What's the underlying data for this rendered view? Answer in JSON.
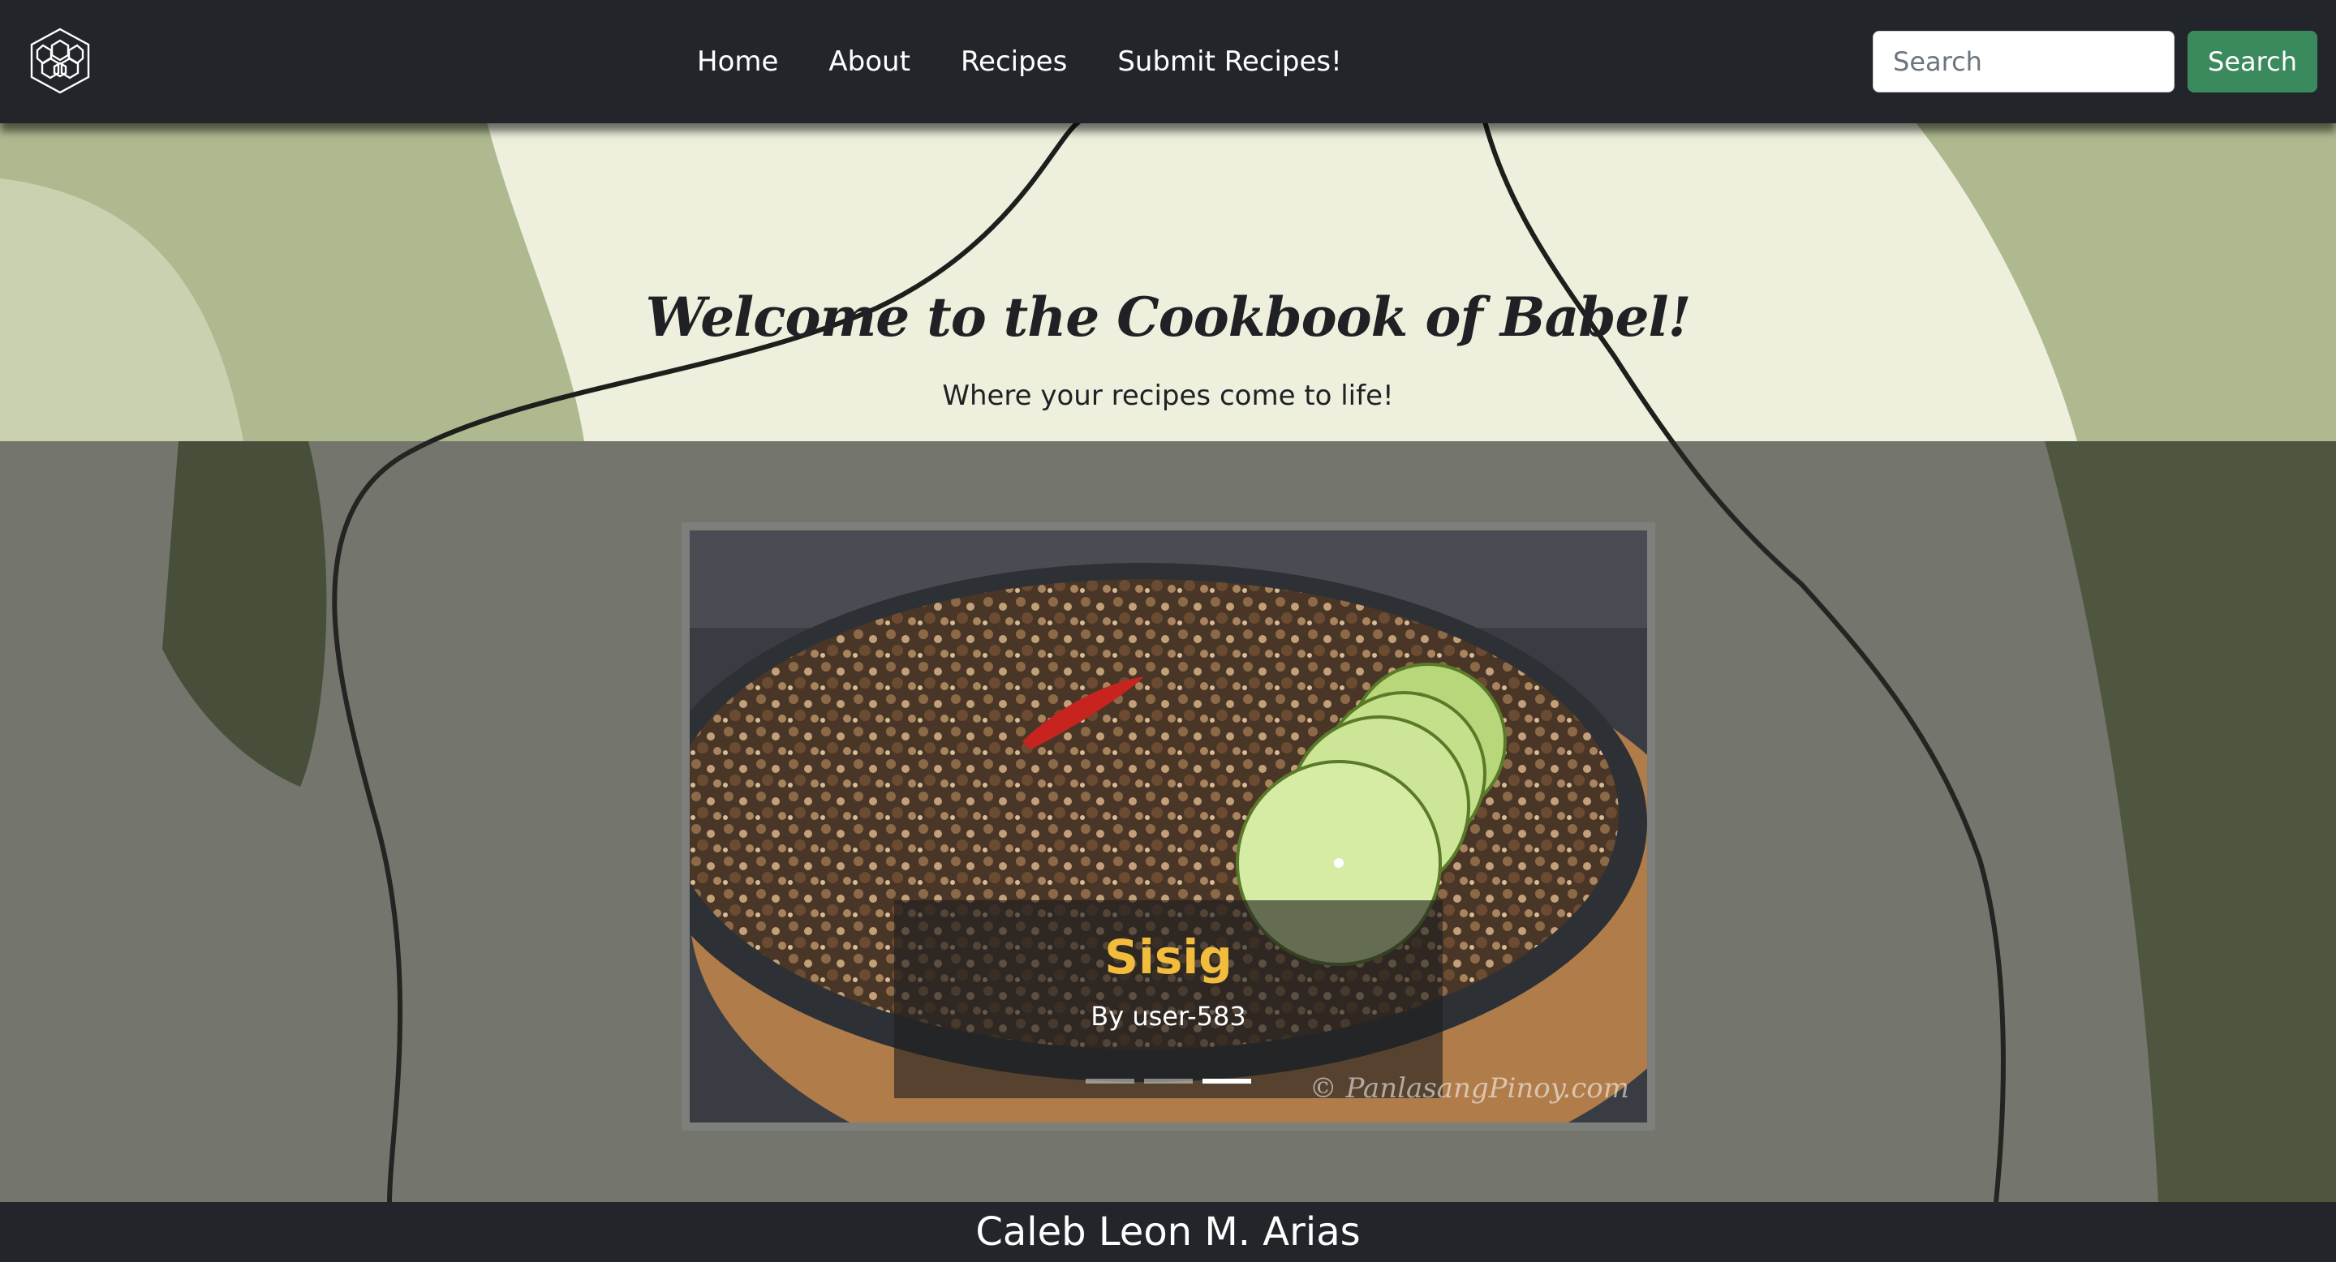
{
  "navbar": {
    "logo_icon": "hexagon-honeycomb-icon",
    "links": [
      {
        "label": "Home"
      },
      {
        "label": "About"
      },
      {
        "label": "Recipes"
      },
      {
        "label": "Submit Recipes!"
      }
    ],
    "search": {
      "placeholder": "Search",
      "button_label": "Search"
    }
  },
  "hero": {
    "title": "Welcome to the Cookbook of Babel!",
    "subtitle": "Where your recipes come to life!"
  },
  "carousel": {
    "slide": {
      "title": "Sisig",
      "author": "By user-583",
      "watermark": "© PanlasangPinoy.com"
    },
    "indicator_count": 3,
    "active_indicator": 3
  },
  "footer": {
    "text": "Caleb Leon M. Arias"
  },
  "colors": {
    "navbar_bg": "#22262b",
    "search_button": "#3b8a5e",
    "caption_title": "#f2bd3c"
  }
}
